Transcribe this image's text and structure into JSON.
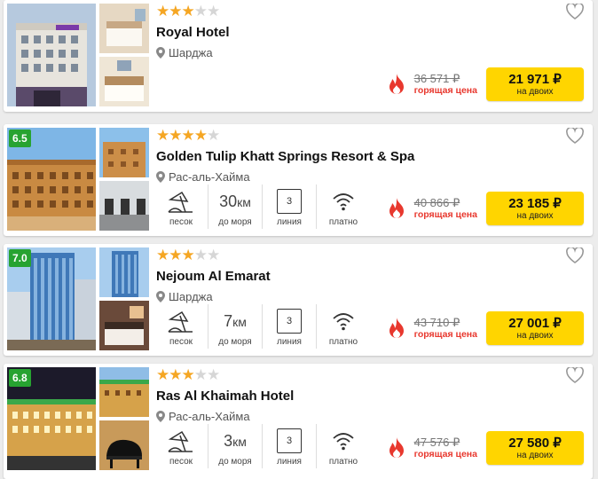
{
  "hotels": [
    {
      "name": "Royal Hotel",
      "stars": 3,
      "location": "Шарджа",
      "rating": "",
      "old_price": "36 571 ₽",
      "hot_label": "горящая цена",
      "price": "21 971 ₽",
      "price_note": "на двоих",
      "features": null
    },
    {
      "name": "Golden Tulip Khatt Springs Resort & Spa",
      "stars": 4,
      "location": "Рас-аль-Хайма",
      "rating": "6.5",
      "old_price": "40 866 ₽",
      "hot_label": "горящая цена",
      "price": "23 185 ₽",
      "price_note": "на двоих",
      "features": {
        "beach": "песок",
        "distance": "30",
        "distance_unit": "км",
        "distance_label": "до моря",
        "line": "3",
        "line_label": "линия",
        "wifi": "платно"
      }
    },
    {
      "name": "Nejoum Al Emarat",
      "stars": 3,
      "location": "Шарджа",
      "rating": "7.0",
      "old_price": "43 710 ₽",
      "hot_label": "горящая цена",
      "price": "27 001 ₽",
      "price_note": "на двоих",
      "features": {
        "beach": "песок",
        "distance": "7",
        "distance_unit": "км",
        "distance_label": "до моря",
        "line": "3",
        "line_label": "линия",
        "wifi": "платно"
      }
    },
    {
      "name": "Ras Al Khaimah Hotel",
      "stars": 3,
      "location": "Рас-аль-Хайма",
      "rating": "6.8",
      "old_price": "47 576 ₽",
      "hot_label": "горящая цена",
      "price": "27 580 ₽",
      "price_note": "на двоих",
      "features": {
        "beach": "песок",
        "distance": "3",
        "distance_unit": "км",
        "distance_label": "до моря",
        "line": "3",
        "line_label": "линия",
        "wifi": "платно"
      }
    }
  ],
  "icons": {
    "star": "star-icon",
    "heart": "heart-icon",
    "pin": "location-pin-icon",
    "fire": "fire-icon",
    "beach": "beach-umbrella-icon",
    "wifi": "wifi-icon"
  },
  "colors": {
    "star_on": "#f5a623",
    "star_off": "#d6d6d6",
    "rating_badge": "#27a331",
    "price_button": "#ffd500",
    "hot_price": "#e8382e"
  }
}
